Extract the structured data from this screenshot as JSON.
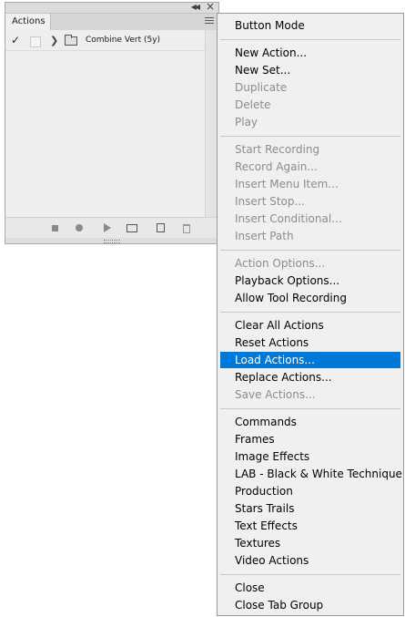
{
  "panel": {
    "tab_label": "Actions",
    "rows": [
      {
        "label": "Combine Vert (5y)",
        "checked": true
      }
    ],
    "tools": [
      "stop-icon",
      "record-icon",
      "play-icon",
      "new-set-icon",
      "new-action-icon",
      "delete-icon"
    ]
  },
  "menu": {
    "items": [
      {
        "label": "Button Mode",
        "disabled": false
      },
      {
        "label": "New Action...",
        "disabled": false
      },
      {
        "label": "New Set...",
        "disabled": false
      },
      {
        "label": "Duplicate",
        "disabled": true
      },
      {
        "label": "Delete",
        "disabled": true
      },
      {
        "label": "Play",
        "disabled": true
      },
      {
        "label": "Start Recording",
        "disabled": true
      },
      {
        "label": "Record Again...",
        "disabled": true
      },
      {
        "label": "Insert Menu Item...",
        "disabled": true
      },
      {
        "label": "Insert Stop...",
        "disabled": true
      },
      {
        "label": "Insert Conditional...",
        "disabled": true
      },
      {
        "label": "Insert Path",
        "disabled": true
      },
      {
        "label": "Action Options...",
        "disabled": true
      },
      {
        "label": "Playback Options...",
        "disabled": false
      },
      {
        "label": "Allow Tool Recording",
        "disabled": false
      },
      {
        "label": "Clear All Actions",
        "disabled": false
      },
      {
        "label": "Reset Actions",
        "disabled": false
      },
      {
        "label": "Load Actions...",
        "disabled": false,
        "highlighted": true
      },
      {
        "label": "Replace Actions...",
        "disabled": false
      },
      {
        "label": "Save Actions...",
        "disabled": true
      },
      {
        "label": "Commands",
        "disabled": false
      },
      {
        "label": "Frames",
        "disabled": false
      },
      {
        "label": "Image Effects",
        "disabled": false
      },
      {
        "label": "LAB - Black & White Technique",
        "disabled": false
      },
      {
        "label": "Production",
        "disabled": false
      },
      {
        "label": "Stars Trails",
        "disabled": false
      },
      {
        "label": "Text Effects",
        "disabled": false
      },
      {
        "label": "Textures",
        "disabled": false
      },
      {
        "label": "Video Actions",
        "disabled": false
      },
      {
        "label": "Close",
        "disabled": false
      },
      {
        "label": "Close Tab Group",
        "disabled": false
      }
    ],
    "highlight_color": "#0078d7"
  }
}
